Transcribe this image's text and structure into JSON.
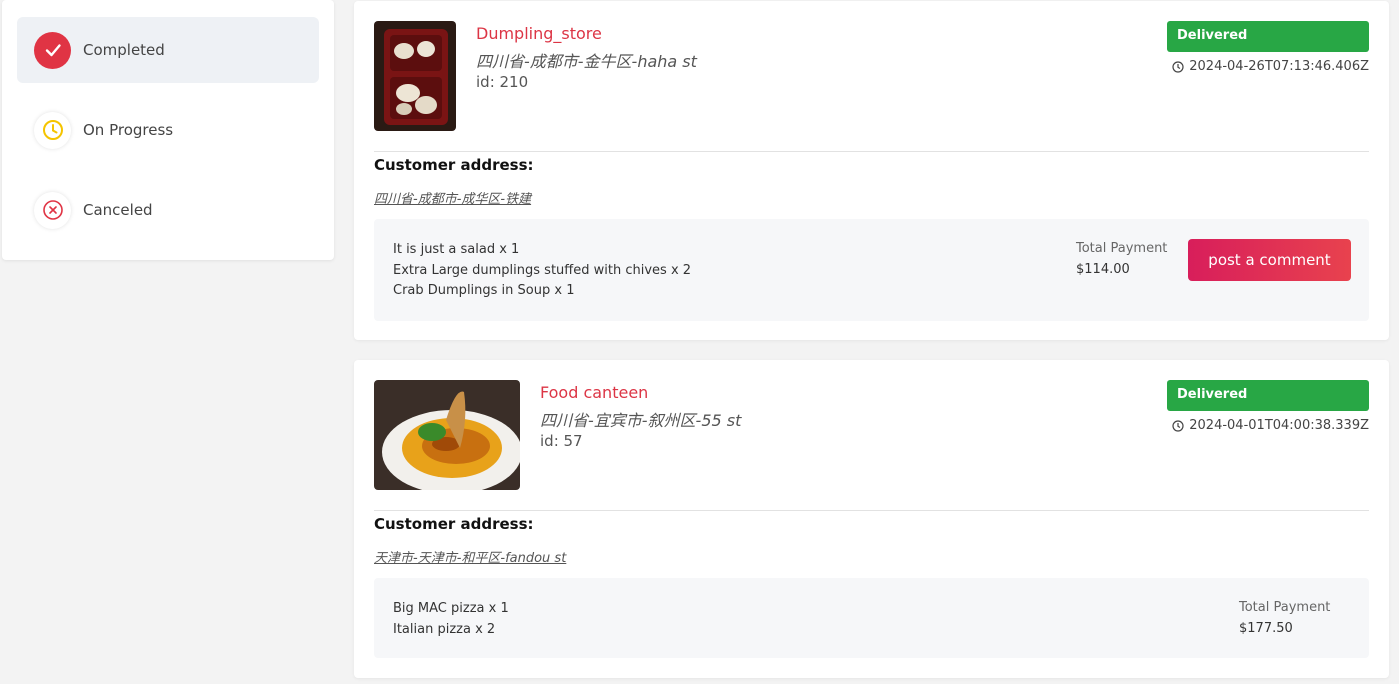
{
  "sidebar": {
    "items": [
      {
        "label": "Completed",
        "icon": "check-circle-icon",
        "active": true
      },
      {
        "label": "On Progress",
        "icon": "clock-icon",
        "active": false
      },
      {
        "label": "Canceled",
        "icon": "x-circle-icon",
        "active": false
      }
    ]
  },
  "colors": {
    "accent": "#e03444",
    "delivered": "#28a745",
    "progress": "#f5c400",
    "store_name": "#dc3545"
  },
  "orders": [
    {
      "store_name": "Dumpling_store",
      "store_address": "四川省-成都市-金牛区-haha st",
      "store_id": "id: 210",
      "status": "Delivered",
      "timestamp": "2024-04-26T07:13:46.406Z",
      "customer_address_heading": "Customer address:",
      "customer_address": "四川省-成都市-成华区-铁建",
      "items": [
        "It is just a salad x 1",
        "Extra Large dumplings stuffed with chives x 2",
        "Crab Dumplings in Soup x 1"
      ],
      "total_payment_label": "Total Payment",
      "total_payment": "$114.00",
      "comment_button": "post a comment"
    },
    {
      "store_name": "Food canteen",
      "store_address": "四川省-宜宾市-叙州区-55 st",
      "store_id": "id: 57",
      "status": "Delivered",
      "timestamp": "2024-04-01T04:00:38.339Z",
      "customer_address_heading": "Customer address:",
      "customer_address": "天津市-天津市-和平区-fandou st",
      "items": [
        "Big MAC pizza x 1",
        "Italian pizza x 2"
      ],
      "total_payment_label": "Total Payment",
      "total_payment": "$177.50"
    }
  ]
}
